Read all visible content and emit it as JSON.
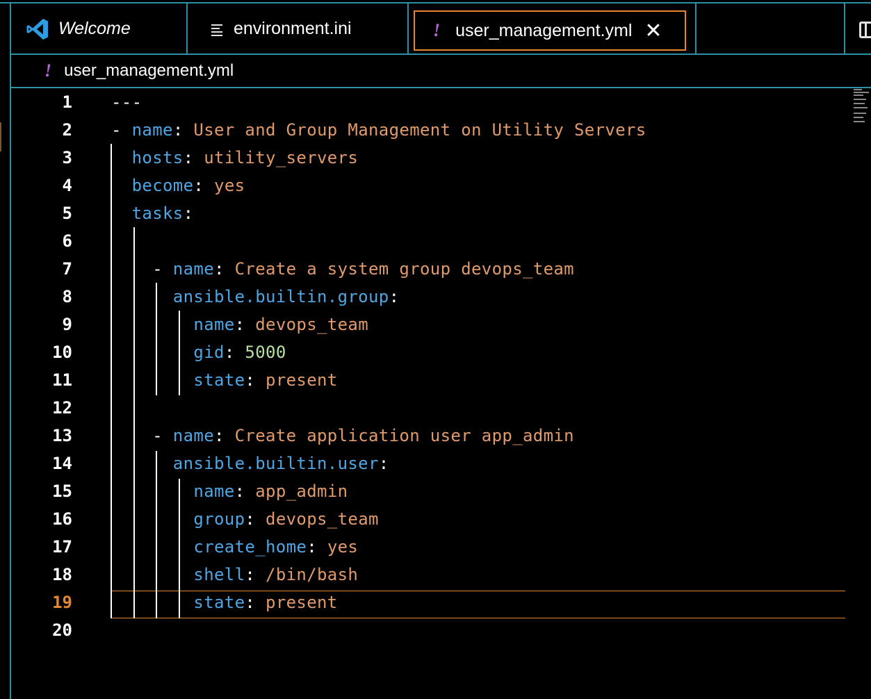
{
  "tabs": [
    {
      "label": "Welcome"
    },
    {
      "label": "environment.ini"
    },
    {
      "label": "user_management.yml",
      "close": "✕"
    }
  ],
  "breadcrumb": {
    "file": "user_management.yml"
  },
  "editor": {
    "active_line": 19,
    "line_numbers": [
      "1",
      "2",
      "3",
      "4",
      "5",
      "6",
      "7",
      "8",
      "9",
      "10",
      "11",
      "12",
      "13",
      "14",
      "15",
      "16",
      "17",
      "18",
      "19",
      "20"
    ],
    "lines": [
      [
        {
          "t": "---",
          "c": "p"
        }
      ],
      [
        {
          "t": "- ",
          "c": "p"
        },
        {
          "t": "name",
          "c": "k"
        },
        {
          "t": ": ",
          "c": "p"
        },
        {
          "t": "User and Group Management on Utility Servers",
          "c": "s"
        }
      ],
      [
        {
          "t": "  ",
          "c": "p"
        },
        {
          "t": "hosts",
          "c": "k"
        },
        {
          "t": ": ",
          "c": "p"
        },
        {
          "t": "utility_servers",
          "c": "s"
        }
      ],
      [
        {
          "t": "  ",
          "c": "p"
        },
        {
          "t": "become",
          "c": "k"
        },
        {
          "t": ": ",
          "c": "p"
        },
        {
          "t": "yes",
          "c": "s"
        }
      ],
      [
        {
          "t": "  ",
          "c": "p"
        },
        {
          "t": "tasks",
          "c": "k"
        },
        {
          "t": ":",
          "c": "p"
        }
      ],
      [],
      [
        {
          "t": "    - ",
          "c": "p"
        },
        {
          "t": "name",
          "c": "k"
        },
        {
          "t": ": ",
          "c": "p"
        },
        {
          "t": "Create a system group devops_team",
          "c": "s"
        }
      ],
      [
        {
          "t": "      ",
          "c": "p"
        },
        {
          "t": "ansible.builtin.group",
          "c": "k"
        },
        {
          "t": ":",
          "c": "p"
        }
      ],
      [
        {
          "t": "        ",
          "c": "p"
        },
        {
          "t": "name",
          "c": "k"
        },
        {
          "t": ": ",
          "c": "p"
        },
        {
          "t": "devops_team",
          "c": "s"
        }
      ],
      [
        {
          "t": "        ",
          "c": "p"
        },
        {
          "t": "gid",
          "c": "k"
        },
        {
          "t": ": ",
          "c": "p"
        },
        {
          "t": "5000",
          "c": "n"
        }
      ],
      [
        {
          "t": "        ",
          "c": "p"
        },
        {
          "t": "state",
          "c": "k"
        },
        {
          "t": ": ",
          "c": "p"
        },
        {
          "t": "present",
          "c": "s"
        }
      ],
      [],
      [
        {
          "t": "    - ",
          "c": "p"
        },
        {
          "t": "name",
          "c": "k"
        },
        {
          "t": ": ",
          "c": "p"
        },
        {
          "t": "Create application user app_admin",
          "c": "s"
        }
      ],
      [
        {
          "t": "      ",
          "c": "p"
        },
        {
          "t": "ansible.builtin.user",
          "c": "k"
        },
        {
          "t": ":",
          "c": "p"
        }
      ],
      [
        {
          "t": "        ",
          "c": "p"
        },
        {
          "t": "name",
          "c": "k"
        },
        {
          "t": ": ",
          "c": "p"
        },
        {
          "t": "app_admin",
          "c": "s"
        }
      ],
      [
        {
          "t": "        ",
          "c": "p"
        },
        {
          "t": "group",
          "c": "k"
        },
        {
          "t": ": ",
          "c": "p"
        },
        {
          "t": "devops_team",
          "c": "s"
        }
      ],
      [
        {
          "t": "        ",
          "c": "p"
        },
        {
          "t": "create_home",
          "c": "k"
        },
        {
          "t": ": ",
          "c": "p"
        },
        {
          "t": "yes",
          "c": "s"
        }
      ],
      [
        {
          "t": "        ",
          "c": "p"
        },
        {
          "t": "shell",
          "c": "k"
        },
        {
          "t": ": ",
          "c": "p"
        },
        {
          "t": "/bin/bash",
          "c": "s"
        }
      ],
      [
        {
          "t": "        ",
          "c": "p"
        },
        {
          "t": "state",
          "c": "k"
        },
        {
          "t": ": ",
          "c": "p"
        },
        {
          "t": "present",
          "c": "s"
        }
      ],
      []
    ]
  },
  "colors": {
    "border": "#2b8fa6",
    "active_tab_border": "#e8862d",
    "yaml_key": "#4fa6e4",
    "yaml_string": "#e09a6b",
    "yaml_number": "#b5e3a1",
    "yml_icon": "#b366d9"
  },
  "icons": [
    "vscode-logo-icon",
    "ini-file-icon",
    "yaml-file-icon",
    "close-icon",
    "split-editor-icon"
  ]
}
